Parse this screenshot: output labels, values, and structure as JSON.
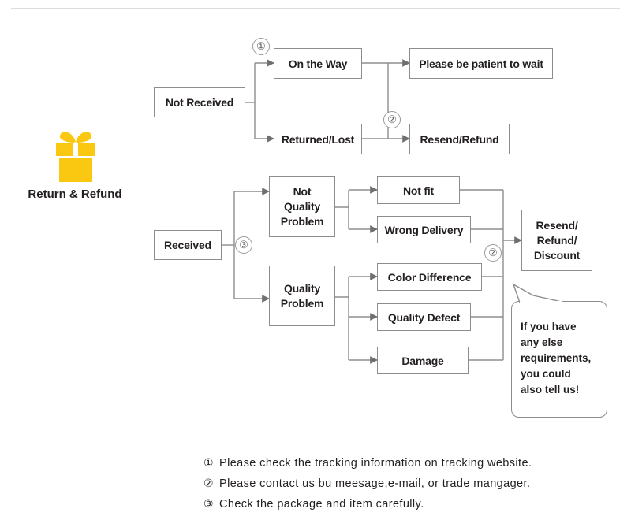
{
  "title": "Return & Refund",
  "icon": {
    "name": "gift-icon",
    "color": "#fac711"
  },
  "flow": {
    "not_received": {
      "root": "Not Received",
      "branches": [
        {
          "label": "On the Way",
          "marker": "①",
          "outcome": "Please be patient to wait"
        },
        {
          "label": "Returned/Lost",
          "marker": "②",
          "outcome": "Resend/Refund"
        }
      ]
    },
    "received": {
      "root": "Received",
      "marker": "③",
      "categories": [
        {
          "label": "Not\nQuality\nProblem",
          "reasons": [
            "Not fit",
            "Wrong Delivery"
          ]
        },
        {
          "label": "Quality\nProblem",
          "reasons": [
            "Color Difference",
            "Quality Defect",
            "Damage"
          ]
        }
      ],
      "outcome_marker": "②",
      "outcome": "Resend/\nRefund/\nDiscount"
    }
  },
  "bubble": {
    "text": "If you have\nany else\nrequirements,\nyou could\nalso tell us!"
  },
  "notes": [
    {
      "num": "①",
      "text": "Please check the tracking information on tracking website."
    },
    {
      "num": "②",
      "text": "Please contact us bu meesage,e-mail, or trade mangager."
    },
    {
      "num": "③",
      "text": "Check the package and item carefully."
    }
  ],
  "colors": {
    "line": "#8d8d8d",
    "text": "#231f20",
    "accent": "#fac711"
  }
}
